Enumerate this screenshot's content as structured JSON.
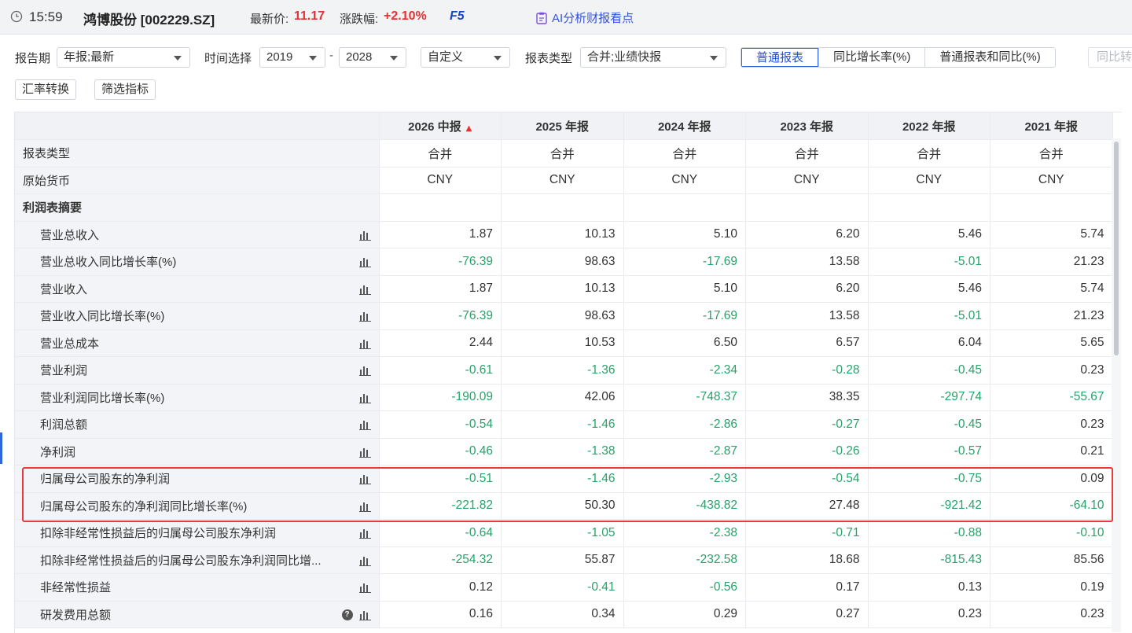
{
  "header": {
    "time": "15:59",
    "stock": "鸿博股份 [002229.SZ]",
    "price_label": "最新价:",
    "price": "11.17",
    "change_label": "涨跌幅:",
    "change": "+2.10%",
    "hotkey": "F5",
    "ai_link": "AI分析财报看点",
    "accent_color": "#e8312f",
    "link_color": "#3553d6"
  },
  "filters": {
    "period_label": "报告期",
    "period_value": "年报;最新",
    "time_label": "时间选择",
    "time_from": "2019",
    "time_sep": "-",
    "time_to": "2028",
    "custom": "自定义",
    "type_label": "报表类型",
    "type_value": "合并;业绩快报",
    "view_options": [
      "普通报表",
      "同比增长率(%)",
      "普通报表和同比(%)"
    ],
    "view_active": "普通报表",
    "disabled_option": "同比转",
    "fx_button": "汇率转换",
    "filter_button": "筛选指标"
  },
  "table": {
    "columns": [
      "2026 中报",
      "2025 年报",
      "2024 年报",
      "2023 年报",
      "2022 年报",
      "2021 年报"
    ],
    "rows": [
      {
        "label": "报表类型",
        "kind": "text",
        "values": [
          "合并",
          "合并",
          "合并",
          "合并",
          "合并",
          "合并"
        ]
      },
      {
        "label": "原始货币",
        "kind": "text",
        "values": [
          "CNY",
          "CNY",
          "CNY",
          "CNY",
          "CNY",
          "CNY"
        ]
      },
      {
        "label": "利润表摘要",
        "kind": "section",
        "values": [
          "",
          "",
          "",
          "",
          "",
          ""
        ]
      },
      {
        "label": "营业总收入",
        "kind": "num",
        "values": [
          "1.87",
          "10.13",
          "5.10",
          "6.20",
          "5.46",
          "5.74"
        ]
      },
      {
        "label": "营业总收入同比增长率(%)",
        "kind": "num",
        "values": [
          "-76.39",
          "98.63",
          "-17.69",
          "13.58",
          "-5.01",
          "21.23"
        ]
      },
      {
        "label": "营业收入",
        "kind": "num",
        "values": [
          "1.87",
          "10.13",
          "5.10",
          "6.20",
          "5.46",
          "5.74"
        ]
      },
      {
        "label": "营业收入同比增长率(%)",
        "kind": "num",
        "values": [
          "-76.39",
          "98.63",
          "-17.69",
          "13.58",
          "-5.01",
          "21.23"
        ]
      },
      {
        "label": "营业总成本",
        "kind": "num",
        "values": [
          "2.44",
          "10.53",
          "6.50",
          "6.57",
          "6.04",
          "5.65"
        ]
      },
      {
        "label": "营业利润",
        "kind": "num",
        "values": [
          "-0.61",
          "-1.36",
          "-2.34",
          "-0.28",
          "-0.45",
          "0.23"
        ]
      },
      {
        "label": "营业利润同比增长率(%)",
        "kind": "num",
        "values": [
          "-190.09",
          "42.06",
          "-748.37",
          "38.35",
          "-297.74",
          "-55.67"
        ]
      },
      {
        "label": "利润总额",
        "kind": "num",
        "values": [
          "-0.54",
          "-1.46",
          "-2.86",
          "-0.27",
          "-0.45",
          "0.23"
        ]
      },
      {
        "label": "净利润",
        "kind": "num",
        "values": [
          "-0.46",
          "-1.38",
          "-2.87",
          "-0.26",
          "-0.57",
          "0.21"
        ]
      },
      {
        "label": "归属母公司股东的净利润",
        "kind": "num",
        "values": [
          "-0.51",
          "-1.46",
          "-2.93",
          "-0.54",
          "-0.75",
          "0.09"
        ]
      },
      {
        "label": "归属母公司股东的净利润同比增长率(%)",
        "kind": "num",
        "values": [
          "-221.82",
          "50.30",
          "-438.82",
          "27.48",
          "-921.42",
          "-64.10"
        ]
      },
      {
        "label": "扣除非经常性损益后的归属母公司股东净利润",
        "kind": "num",
        "values": [
          "-0.64",
          "-1.05",
          "-2.38",
          "-0.71",
          "-0.88",
          "-0.10"
        ]
      },
      {
        "label": "扣除非经常性损益后的归属母公司股东净利润同比增...",
        "kind": "num",
        "values": [
          "-254.32",
          "55.87",
          "-232.58",
          "18.68",
          "-815.43",
          "85.56"
        ]
      },
      {
        "label": "非经常性损益",
        "kind": "num",
        "values": [
          "0.12",
          "-0.41",
          "-0.56",
          "0.17",
          "0.13",
          "0.19"
        ]
      },
      {
        "label": "研发费用总额",
        "kind": "num",
        "help": true,
        "values": [
          "0.16",
          "0.34",
          "0.29",
          "0.27",
          "0.23",
          "0.23"
        ]
      }
    ]
  }
}
